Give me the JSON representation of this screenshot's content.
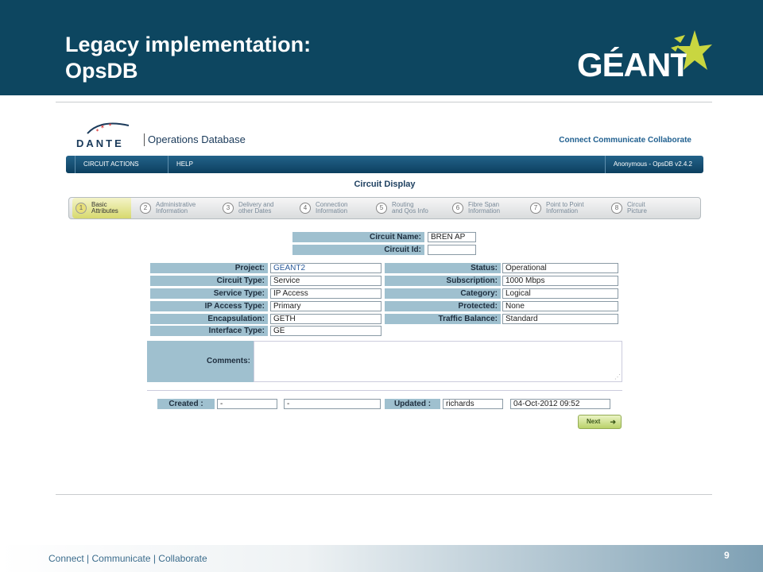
{
  "slide": {
    "title_line1": "Legacy implementation:",
    "title_line2": "OpsDB",
    "logo": "GÉANT",
    "footer": "Connect | Communicate | Collaborate",
    "page_number": "9"
  },
  "app": {
    "brand": "DANTE",
    "title": "Operations Database",
    "tagline": "Connect  Communicate Collaborate",
    "menu": [
      "CIRCUIT ACTIONS",
      "HELP"
    ],
    "user": "Anonymous - OpsDB v2.4.2",
    "panel_title": "Circuit Display"
  },
  "steps": [
    {
      "num": "1",
      "label": "Basic\nAttributes"
    },
    {
      "num": "2",
      "label": "Administrative\nInformation"
    },
    {
      "num": "3",
      "label": "Delivery and\nother Dates"
    },
    {
      "num": "4",
      "label": "Connection\nInformation"
    },
    {
      "num": "5",
      "label": "Routing\nand Qos Info"
    },
    {
      "num": "6",
      "label": "Fibre Span\nInformation"
    },
    {
      "num": "7",
      "label": "Point to Point\nInformation"
    },
    {
      "num": "8",
      "label": "Circuit\nPicture"
    }
  ],
  "circuit": {
    "name_label": "Circuit Name:",
    "name": "BREN AP",
    "id_label": "Circuit Id:",
    "id": ""
  },
  "left_fields": [
    {
      "label": "Project:",
      "value": "GEANT2"
    },
    {
      "label": "Circuit Type:",
      "value": "Service"
    },
    {
      "label": "Service Type:",
      "value": "IP Access"
    },
    {
      "label": "IP Access Type:",
      "value": "Primary"
    },
    {
      "label": "Encapsulation:",
      "value": "GETH"
    },
    {
      "label": "Interface Type:",
      "value": "GE"
    }
  ],
  "right_fields": [
    {
      "label": "Status:",
      "value": "Operational"
    },
    {
      "label": "Subscription:",
      "value": "1000 Mbps"
    },
    {
      "label": "Category:",
      "value": "Logical"
    },
    {
      "label": "Protected:",
      "value": "None"
    },
    {
      "label": "Traffic Balance:",
      "value": "Standard"
    }
  ],
  "comments_label": "Comments:",
  "meta": {
    "created_label": "Created :",
    "created_by": "-",
    "created_on": "-",
    "updated_label": "Updated :",
    "updated_by": "richards",
    "updated_on": "04-Oct-2012 09:52"
  },
  "next_label": "Next"
}
